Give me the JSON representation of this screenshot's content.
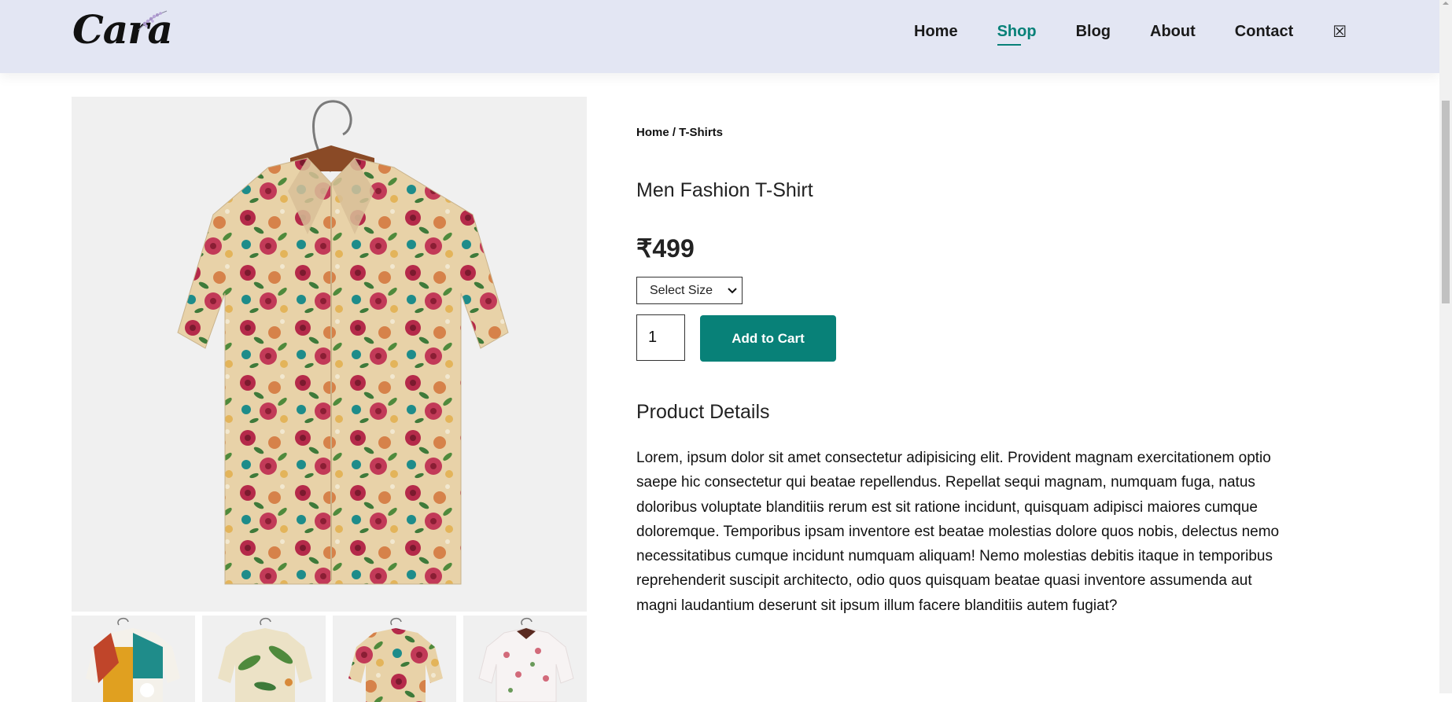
{
  "header": {
    "logo_text": "Cara",
    "nav": [
      {
        "label": "Home",
        "active": false
      },
      {
        "label": "Shop",
        "active": true
      },
      {
        "label": "Blog",
        "active": false
      },
      {
        "label": "About",
        "active": false
      },
      {
        "label": "Contact",
        "active": false
      }
    ],
    "cart_icon": "bag-icon",
    "accent": "#088178",
    "background": "#e3e6f3"
  },
  "product": {
    "breadcrumb": "Home / T-Shirts",
    "title": "Men Fashion T-Shirt",
    "price": "₹499",
    "size_select": {
      "selected": "Select Size"
    },
    "quantity": "1",
    "add_to_cart_label": "Add to Cart",
    "details_heading": "Product Details",
    "details_text": "Lorem, ipsum dolor sit amet consectetur adipisicing elit. Provident magnam exercitationem optio saepe hic consectetur qui beatae repellendus. Repellat sequi magnam, numquam fuga, natus doloribus voluptate blanditiis rerum est sit ratione incidunt, quisquam adipisci maiores cumque doloremque. Temporibus ipsam inventore est beatae molestias dolore quos nobis, delectus nemo necessitatibus cumque incidunt numquam aliquam! Nemo molestias debitis itaque in temporibus reprehenderit suscipit architecto, odio quos quisquam beatae quasi inventore assumenda aut magni laudantium deserunt sit ipsum illum facere blanditiis autem fugiat?"
  },
  "images": {
    "main": {
      "kind": "floral-shirt",
      "colors": [
        "#e8d2a8",
        "#b52a4a",
        "#3e7a3a",
        "#1e8c8a"
      ]
    },
    "thumbnails": [
      {
        "kind": "patchwork-shirt",
        "colors": [
          "#e0a020",
          "#1f8c8a",
          "#f4f1ea"
        ]
      },
      {
        "kind": "leaf-shirt",
        "colors": [
          "#ece2c6",
          "#4f8a3c",
          "#d88a3a"
        ]
      },
      {
        "kind": "floral-shirt",
        "colors": [
          "#e8d2a8",
          "#b52a4a",
          "#3e7a3a"
        ]
      },
      {
        "kind": "white-floral-shirt",
        "colors": [
          "#f7f3f3",
          "#d26a7a",
          "#6a9a5a"
        ]
      }
    ]
  }
}
